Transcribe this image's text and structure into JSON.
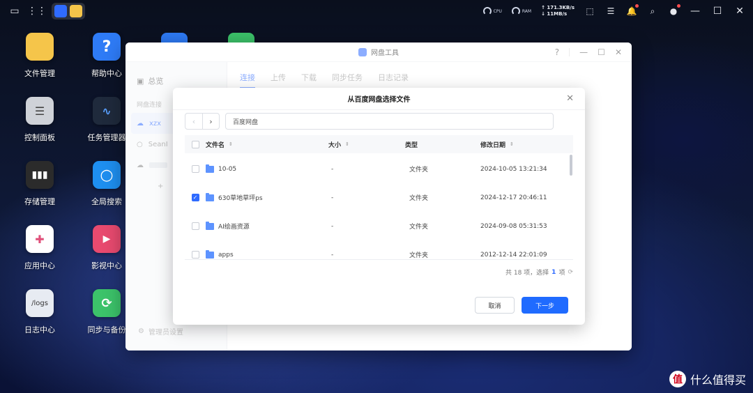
{
  "topbar": {
    "cpu_label": "CPU",
    "ram_label": "RAM",
    "net_up": "↑ 171.3KB/s",
    "net_down": "↓ 11MB/s"
  },
  "desktop_icons": [
    {
      "label": "文件管理",
      "color": "#f5c54a"
    },
    {
      "label": "帮助中心",
      "color": "#2e7bf6",
      "glyph": "?"
    },
    {
      "label": "控制面板",
      "color": "#cfd2d8"
    },
    {
      "label": "任务管理器",
      "color": "#1f2a3c"
    },
    {
      "label": "存储管理",
      "color": "#2b2b2b"
    },
    {
      "label": "全局搜索",
      "color": "#1e8ff0"
    },
    {
      "label": "应用中心",
      "color": "#ffffff"
    },
    {
      "label": "影视中心",
      "color": "#e84a6f"
    },
    {
      "label": "日志中心",
      "color": "#e7ebf2",
      "glyph": "/logs"
    },
    {
      "label": "同步与备份",
      "color": "#3cc36a"
    }
  ],
  "window": {
    "title": "网盘工具",
    "help": "?",
    "sidebar": {
      "overview": "总览",
      "section": "网盘连接",
      "accounts": [
        "xzx",
        "SeanI"
      ],
      "settings": "管理员设置"
    },
    "tabs": [
      "连接",
      "上传",
      "下载",
      "同步任务",
      "日志记录"
    ]
  },
  "dialog": {
    "title": "从百度网盘选择文件",
    "path": "百度网盘",
    "columns": {
      "name": "文件名",
      "size": "大小",
      "type": "类型",
      "date": "修改日期"
    },
    "rows": [
      {
        "name": "10-05",
        "size": "-",
        "type": "文件夹",
        "date": "2024-10-05 13:21:34",
        "checked": false
      },
      {
        "name": "630草地草坪ps",
        "size": "-",
        "type": "文件夹",
        "date": "2024-12-17 20:46:11",
        "checked": true
      },
      {
        "name": "AI绘画资源",
        "size": "-",
        "type": "文件夹",
        "date": "2024-09-08 05:31:53",
        "checked": false
      },
      {
        "name": "apps",
        "size": "-",
        "type": "文件夹",
        "date": "2012-12-14 22:01:09",
        "checked": false
      }
    ],
    "footer": {
      "prefix": "共 18 项，选择",
      "selected": "1",
      "suffix": "项"
    },
    "cancel": "取消",
    "next": "下一步"
  },
  "watermark": {
    "logo": "值",
    "text": "什么值得买"
  }
}
